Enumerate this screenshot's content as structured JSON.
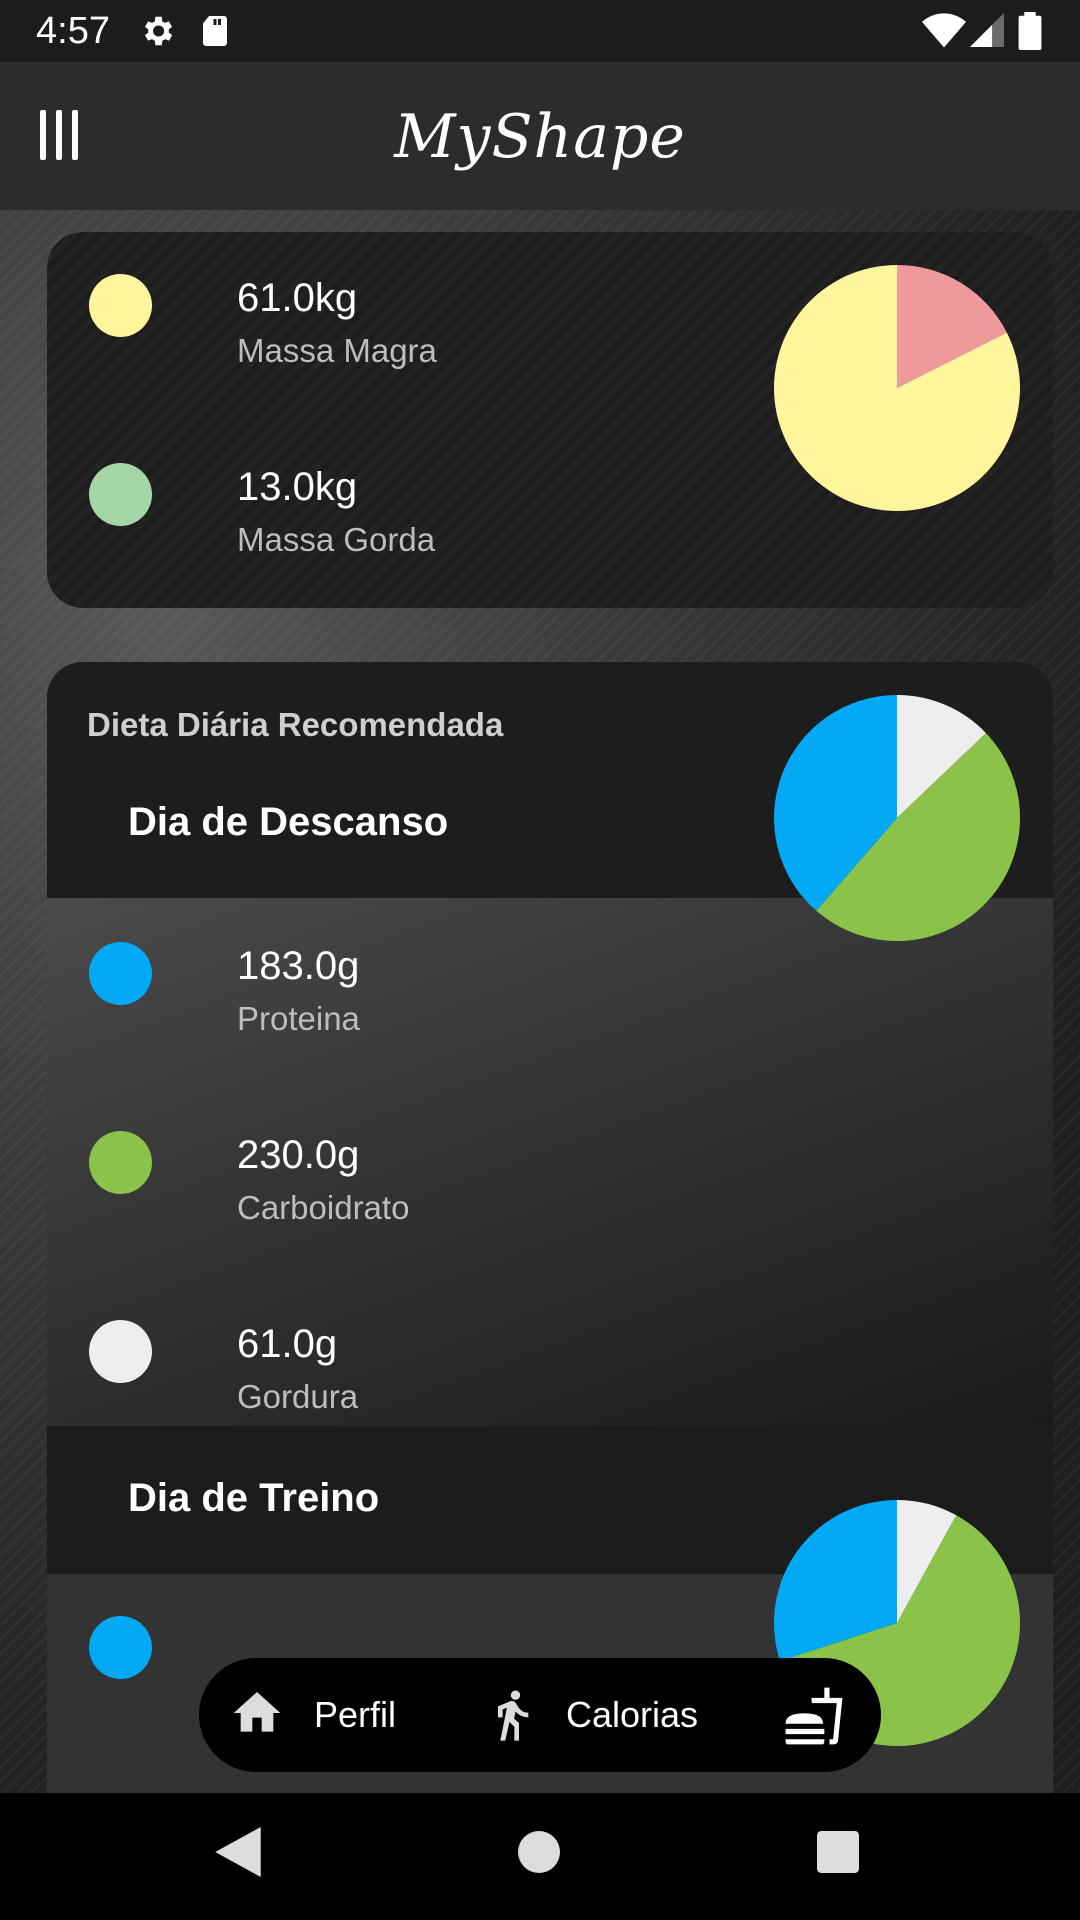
{
  "status_bar": {
    "time": "4:57",
    "icons": [
      "settings-icon",
      "sd-card-icon",
      "wifi-icon",
      "signal-icon",
      "battery-icon"
    ]
  },
  "app_bar": {
    "title": "MyShape",
    "menu_icon": "menu-icon"
  },
  "body_composition": {
    "items": [
      {
        "value": "61.0kg",
        "label": "Massa Magra",
        "color": "#FFF59D"
      },
      {
        "value": "13.0kg",
        "label": "Massa Gorda",
        "color": "#A5D6A7"
      }
    ],
    "chart_colors": {
      "lean": "#FFF59D",
      "fat": "#EF9A9A"
    }
  },
  "diet": {
    "title": "Dieta Diária Recomendada",
    "rest_day": {
      "title": "Dia de Descanso",
      "items": [
        {
          "value": "183.0g",
          "label": "Proteina",
          "color": "#03A9F4"
        },
        {
          "value": "230.0g",
          "label": "Carboidrato",
          "color": "#8BC34A"
        },
        {
          "value": "61.0g",
          "label": "Gordura",
          "color": "#EEEEEE"
        }
      ]
    },
    "training_day": {
      "title": "Dia de Treino",
      "first_item_color": "#03A9F4"
    }
  },
  "chart_data": [
    {
      "type": "pie",
      "categories": [
        "Massa Magra",
        "Massa Gorda"
      ],
      "values": [
        61.0,
        13.0
      ],
      "colors": [
        "#FFF59D",
        "#EF9A9A"
      ]
    },
    {
      "type": "pie",
      "categories": [
        "Proteina",
        "Carboidrato",
        "Gordura"
      ],
      "values": [
        183.0,
        230.0,
        61.0
      ],
      "colors": [
        "#03A9F4",
        "#8BC34A",
        "#EEEEEE"
      ]
    },
    {
      "type": "pie",
      "categories": [
        "Proteina",
        "Carboidrato",
        "Gordura"
      ],
      "values": [
        30,
        62,
        8
      ],
      "colors": [
        "#03A9F4",
        "#8BC34A",
        "#EEEEEE"
      ]
    }
  ],
  "bottom_nav": {
    "items": [
      {
        "label": "Perfil",
        "icon": "home-icon"
      },
      {
        "label": "Calorias",
        "icon": "running-icon"
      },
      {
        "label": "",
        "icon": "fastfood-icon"
      }
    ]
  },
  "system_nav": {
    "buttons": [
      "back-button",
      "home-button",
      "recents-button"
    ]
  }
}
